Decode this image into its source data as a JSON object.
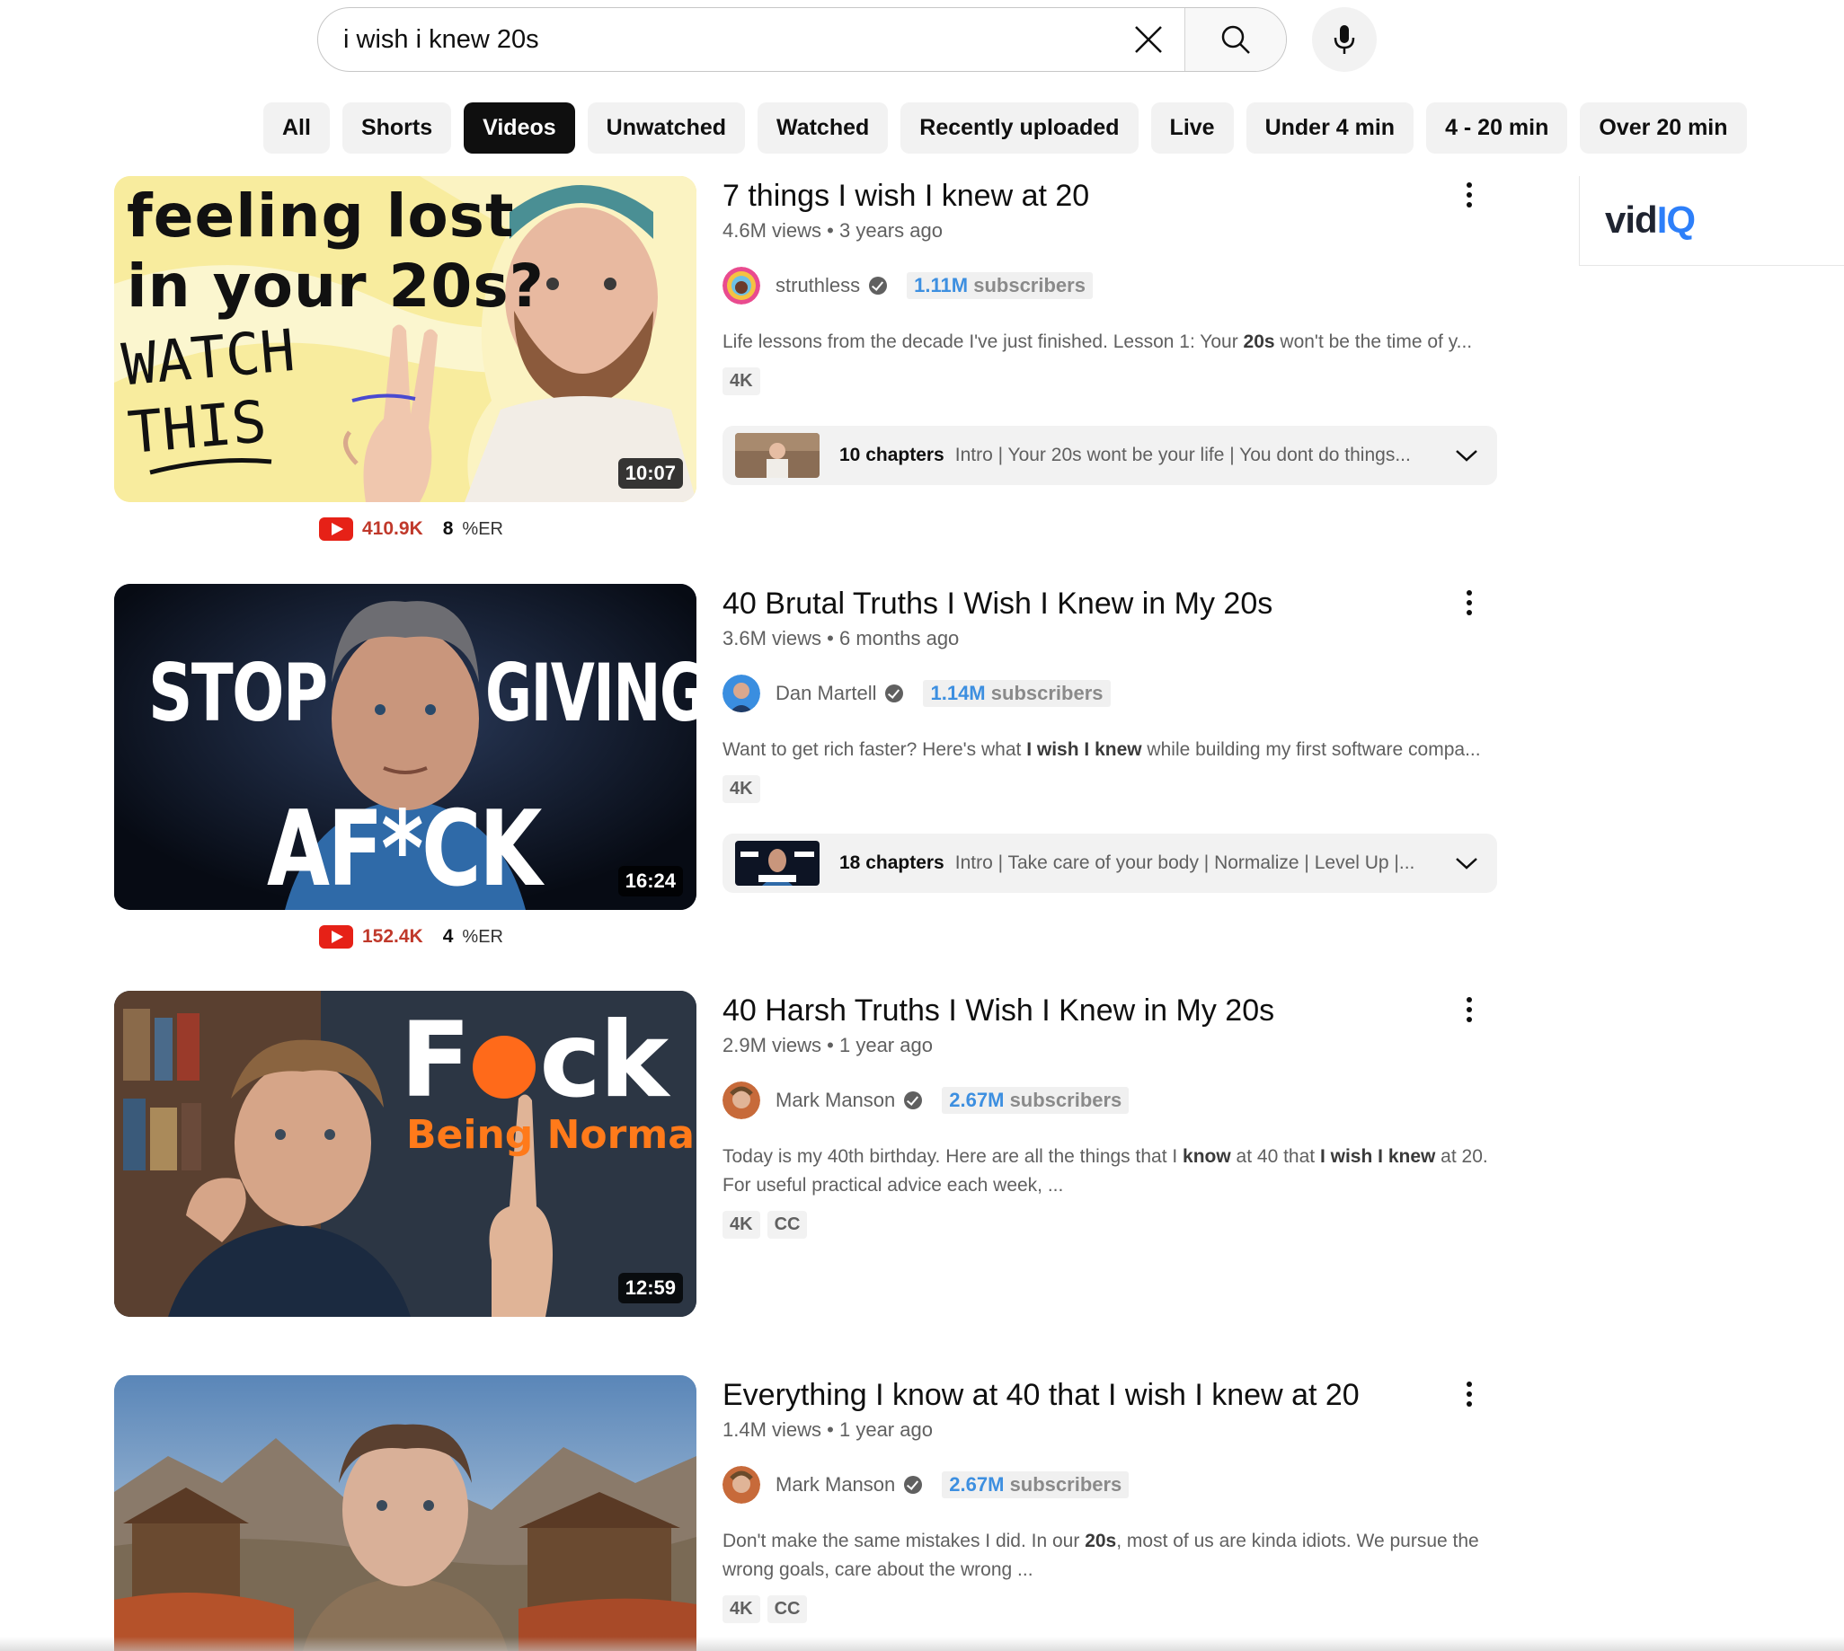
{
  "search": {
    "query": "i wish i knew 20s"
  },
  "chips": [
    "All",
    "Shorts",
    "Videos",
    "Unwatched",
    "Watched",
    "Recently uploaded",
    "Live",
    "Under 4 min",
    "4 - 20 min",
    "Over 20 min"
  ],
  "active_chip": "Videos",
  "vidiq": {
    "brand_a": "vid",
    "brand_b": "IQ"
  },
  "results": [
    {
      "title": "7 things I wish I knew at 20",
      "views": "4.6M views",
      "age": "3 years ago",
      "channel": "struthless",
      "subs_num": "1.11M",
      "subs_label": "subscribers",
      "desc_parts": [
        "Life lessons from the decade I've just finished. Lesson 1: Your ",
        "20s",
        " won't be the time of y..."
      ],
      "badges": [
        "4K"
      ],
      "duration": "10:07",
      "thumb_text": {
        "l1": "feeling lost",
        "l2a": "in your ",
        "l2b": "20s?",
        "l3": "WATCH",
        "l4": "THIS"
      },
      "chapters": {
        "count": "10 chapters",
        "text": "Intro | Your 20s wont be your life | You dont do things..."
      },
      "stats": {
        "views": "410.9K",
        "er": "8",
        "er_label": "%ER"
      }
    },
    {
      "title": "40 Brutal Truths I Wish I Knew in My 20s",
      "views": "3.6M views",
      "age": "6 months ago",
      "channel": "Dan Martell",
      "subs_num": "1.14M",
      "subs_label": "subscribers",
      "desc_parts": [
        "Want to get rich faster? Here's what ",
        "I wish I knew",
        " while building my first software compa..."
      ],
      "badges": [
        "4K"
      ],
      "duration": "16:24",
      "thumb_text": {
        "l1": "STOP",
        "l2": "GIVING",
        "l3": "AF*CK"
      },
      "chapters": {
        "count": "18 chapters",
        "text": "Intro | Take care of your body | Normalize | Level Up |..."
      },
      "stats": {
        "views": "152.4K",
        "er": "4",
        "er_label": "%ER"
      }
    },
    {
      "title": "40 Harsh Truths I Wish I Knew in My 20s",
      "views": "2.9M views",
      "age": "1 year ago",
      "channel": "Mark Manson",
      "subs_num": "2.67M",
      "subs_label": "subscribers",
      "desc_parts": [
        "Today is my 40th birthday. Here are all the things that I ",
        "know",
        " at 40 that ",
        "I wish I knew",
        " at 20. For useful practical advice each week, ..."
      ],
      "badges": [
        "4K",
        "CC"
      ],
      "duration": "12:59",
      "thumb_text": {
        "l1a": "F",
        "l1b": "ck",
        "l2": "Being Normal"
      }
    },
    {
      "title": "Everything I know at 40 that I wish I knew at 20",
      "views": "1.4M views",
      "age": "1 year ago",
      "channel": "Mark Manson",
      "subs_num": "2.67M",
      "subs_label": "subscribers",
      "desc_parts": [
        "Don't make the same mistakes I did. In our ",
        "20s",
        ", most of us are kinda idiots. We pursue the wrong goals, care about the wrong ..."
      ],
      "badges": [
        "4K",
        "CC"
      ]
    }
  ],
  "icons": {
    "clear": "close-icon",
    "search": "search-icon",
    "mic": "microphone-icon",
    "more": "more-vert-icon",
    "chevron": "chevron-down-icon",
    "verified": "verified-check-icon",
    "youtube": "youtube-icon"
  },
  "colors": {
    "accent_blue": "#3d8fe0",
    "youtube_red": "#e62117",
    "chip_active": "#0f0f0f"
  }
}
